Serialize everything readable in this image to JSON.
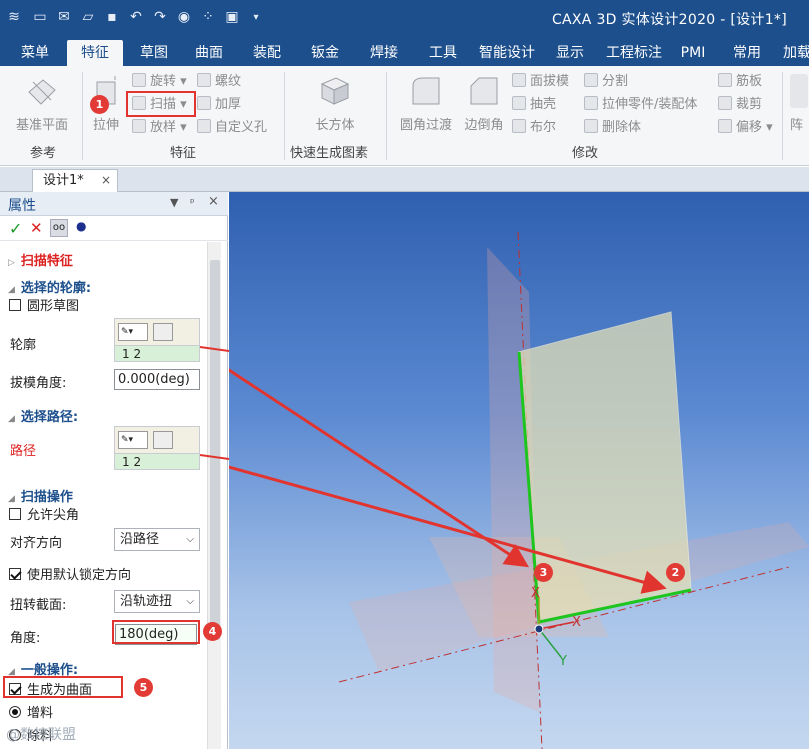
{
  "app": {
    "title": "CAXA 3D 实体设计2020 - [设计1*]"
  },
  "ribbon": {
    "tabs": [
      "菜单",
      "特征",
      "草图",
      "曲面",
      "装配",
      "钣金",
      "焊接",
      "工具",
      "智能设计",
      "显示",
      "工程标注",
      "PMI",
      "常用",
      "加载"
    ],
    "active_tab": "特征",
    "groups": {
      "reference": {
        "label": "参考",
        "datum_plane": "基准平面"
      },
      "features": {
        "label": "特征",
        "extrude": "拉伸",
        "rotate": "旋转",
        "sweep": "扫描",
        "loft": "放样",
        "thread": "螺纹",
        "thicken": "加厚",
        "custom_hole": "自定义孔"
      },
      "quick": {
        "label": "快速生成图素",
        "cuboid": "长方体"
      },
      "modify": {
        "label": "修改",
        "fillet": "圆角过渡",
        "chamfer": "边倒角",
        "draft": "面拔模",
        "shell": "抽壳",
        "boolean": "布尔",
        "split": "分割",
        "extrude_part": "拉伸零件/装配体",
        "delete_body": "删除体",
        "rib": "筋板",
        "trim": "裁剪",
        "offset": "偏移",
        "array": "阵"
      }
    }
  },
  "document": {
    "tab": "设计1*",
    "close": "×"
  },
  "panel": {
    "title": "属性",
    "header_icons": {
      "menu": "▼",
      "pin": "ᵖ",
      "close": "×"
    },
    "tools": {
      "ok": "✓",
      "cancel": "✕",
      "glasses": "👓",
      "dot": "●"
    },
    "feature_title": "扫描特征",
    "profile_section": "选择的轮廓:",
    "circular_sketch": "圆形草图",
    "profile_label": "轮廓",
    "profile_value": "1 2",
    "draft_angle_label": "拔模角度:",
    "draft_angle_value": "0.000(deg)",
    "path_section": "选择路径:",
    "path_label": "路径",
    "path_value": "1 2",
    "sweep_ops_section": "扫描操作",
    "allow_sharp": "允许尖角",
    "align_label": "对齐方向",
    "align_value": "沿路径",
    "use_default_lock": "使用默认锁定方向",
    "twist_label": "扭转截面:",
    "twist_value": "沿轨迹扭",
    "angle_label": "角度:",
    "angle_value": "180(deg)",
    "general_section": "一般操作:",
    "gen_surface": "生成为曲面",
    "add_material": "增料",
    "remove_material": "除料"
  },
  "viewport": {
    "axis_x": "X",
    "axis_y": "Y",
    "axis_z": "X"
  },
  "annotations": [
    "1",
    "2",
    "3",
    "4",
    "5"
  ],
  "watermark": "@数控联盟"
}
